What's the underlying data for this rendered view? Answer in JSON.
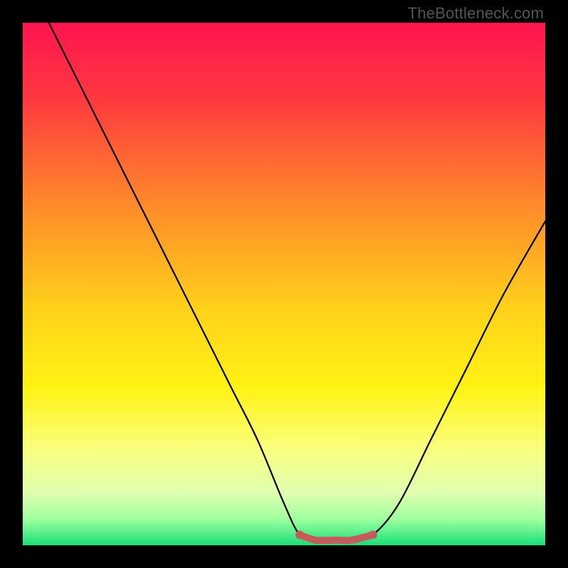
{
  "watermark": "TheBottleneck.com",
  "chart_data": {
    "type": "line",
    "title": "",
    "xlabel": "",
    "ylabel": "",
    "xlim": [
      0,
      100
    ],
    "ylim": [
      0,
      100
    ],
    "series": [
      {
        "name": "bottleneck-curve",
        "x": [
          5,
          10,
          15,
          20,
          25,
          30,
          35,
          40,
          45,
          50,
          53,
          56,
          60,
          63,
          67,
          72,
          78,
          85,
          92,
          100
        ],
        "y": [
          100,
          90,
          80,
          70,
          60,
          50,
          40,
          30,
          20,
          8,
          2,
          1,
          1,
          1,
          2,
          8,
          20,
          34,
          48,
          62
        ]
      },
      {
        "name": "optimal-zone-marker",
        "x": [
          53,
          56,
          60,
          63,
          67
        ],
        "y": [
          2,
          1,
          1,
          1,
          2
        ]
      }
    ],
    "gradient_stops": [
      {
        "pos": 0.0,
        "color": "#ff1450"
      },
      {
        "pos": 0.15,
        "color": "#ff3a3f"
      },
      {
        "pos": 0.35,
        "color": "#ff8b2a"
      },
      {
        "pos": 0.55,
        "color": "#ffd21a"
      },
      {
        "pos": 0.7,
        "color": "#fff314"
      },
      {
        "pos": 0.82,
        "color": "#f9ff82"
      },
      {
        "pos": 0.9,
        "color": "#dfffb0"
      },
      {
        "pos": 0.95,
        "color": "#9eff9e"
      },
      {
        "pos": 1.0,
        "color": "#19e07a"
      }
    ],
    "marker_color": "#c75a5a"
  }
}
